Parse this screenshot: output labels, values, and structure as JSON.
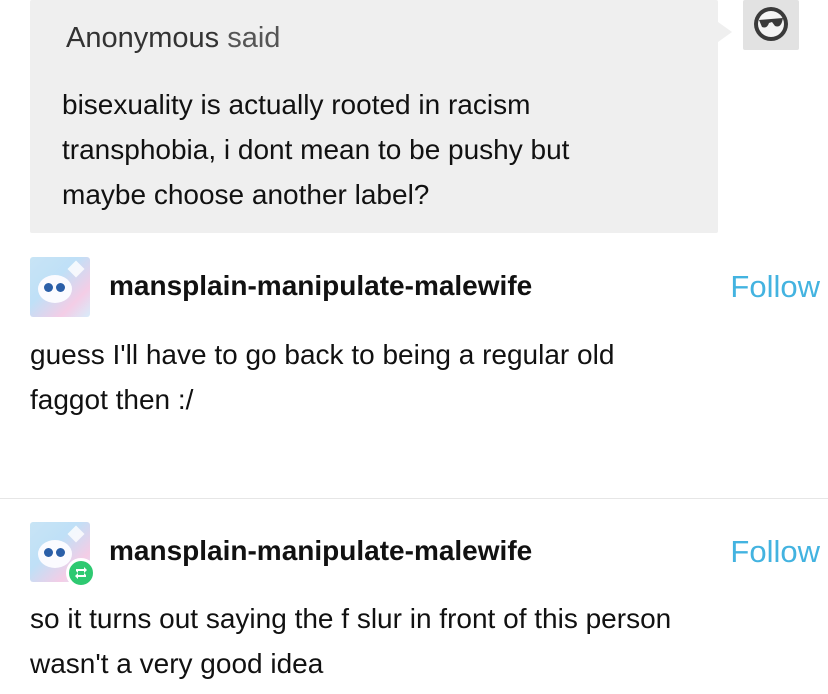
{
  "ask": {
    "asker_name": "Anonymous",
    "asker_verb": "said",
    "question_line1": "bisexuality is actually rooted in racism",
    "question_line2": "transphobia, i dont mean to be pushy but",
    "question_line3": "maybe choose another label?",
    "avatar_icon": "anonymous-sunglasses-icon"
  },
  "posts": [
    {
      "username": "mansplain-manipulate-malewife",
      "follow_label": "Follow",
      "text_line1": "guess I'll have to go back to being a regular old",
      "text_line2": "faggot then :/",
      "reblogged": false
    },
    {
      "username": "mansplain-manipulate-malewife",
      "follow_label": "Follow",
      "text_line1": "so it turns out saying the f slur in front of this person",
      "text_line2": "wasn't a very good idea",
      "reblogged": true,
      "badge_icon": "reblog-icon"
    }
  ],
  "colors": {
    "follow": "#43b3e0",
    "ask_bg": "#efefef",
    "reblog_badge": "#2ec971"
  }
}
